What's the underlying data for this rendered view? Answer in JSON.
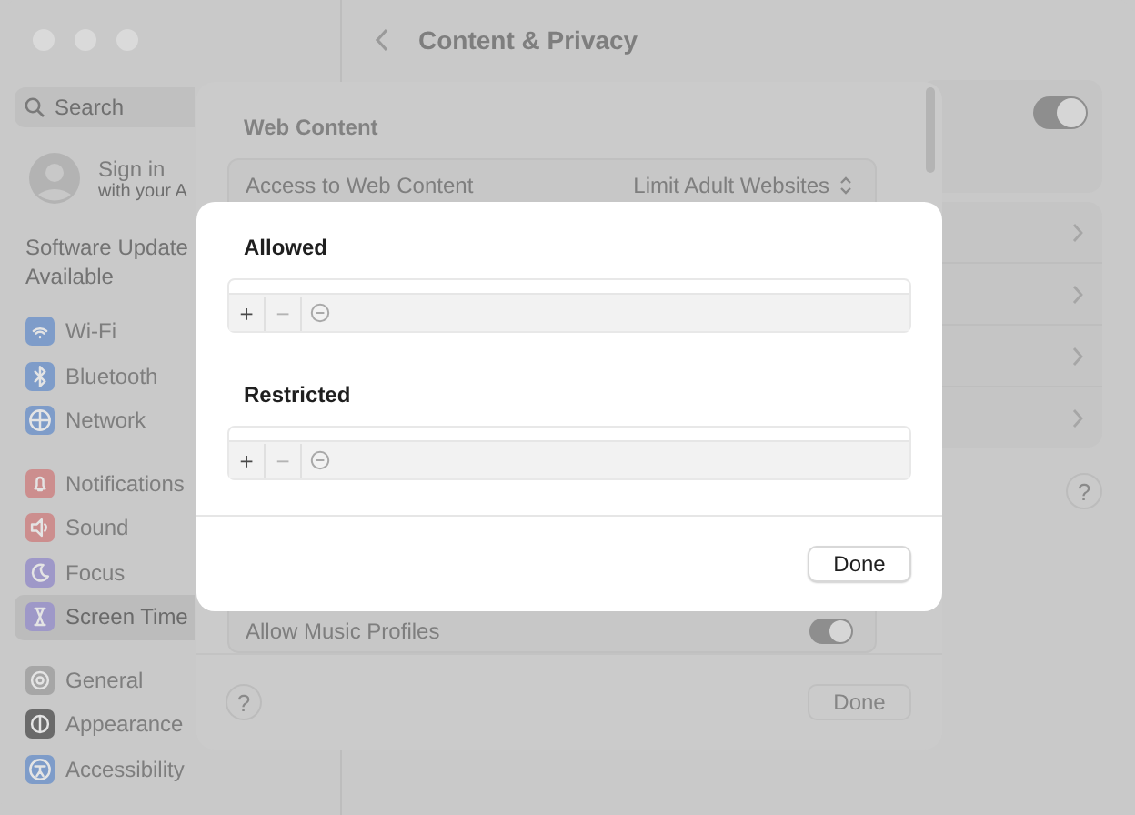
{
  "sidebar": {
    "search": {
      "placeholder": "Search"
    },
    "account": {
      "title": "Sign in",
      "subtitle": "with your A"
    },
    "notice": "Software Update Available",
    "groups": [
      [
        {
          "label": "Wi-Fi",
          "color": "#7e9cc9",
          "selected": false
        },
        {
          "label": "Bluetooth",
          "color": "#7e9cc9",
          "selected": false
        },
        {
          "label": "Network",
          "color": "#7e9cc9",
          "selected": false
        }
      ],
      [
        {
          "label": "Notifications",
          "color": "#cc8e8e",
          "selected": false
        },
        {
          "label": "Sound",
          "color": "#cc8e8e",
          "selected": false
        },
        {
          "label": "Focus",
          "color": "#9e98c8",
          "selected": false
        },
        {
          "label": "Screen Time",
          "color": "#9e98c8",
          "selected": true
        }
      ],
      [
        {
          "label": "General",
          "color": "#a6a6a6",
          "selected": false
        },
        {
          "label": "Appearance",
          "color": "#6a6a6a",
          "selected": false
        },
        {
          "label": "Accessibility",
          "color": "#7e9cc9",
          "selected": false
        }
      ]
    ]
  },
  "header": {
    "title": "Content & Privacy"
  },
  "panel": {
    "toggle_on": true,
    "help": "?"
  },
  "sheet": {
    "section": "Web Content",
    "access": {
      "label": "Access to Web Content",
      "value": "Limit Adult Websites"
    },
    "music": {
      "label": "Allow Music Profiles",
      "on": true
    },
    "help": "?",
    "done": "Done"
  },
  "dialog": {
    "lists": [
      {
        "title": "Allowed",
        "add": "+",
        "remove": "−"
      },
      {
        "title": "Restricted",
        "add": "+",
        "remove": "−"
      }
    ],
    "done": "Done"
  }
}
